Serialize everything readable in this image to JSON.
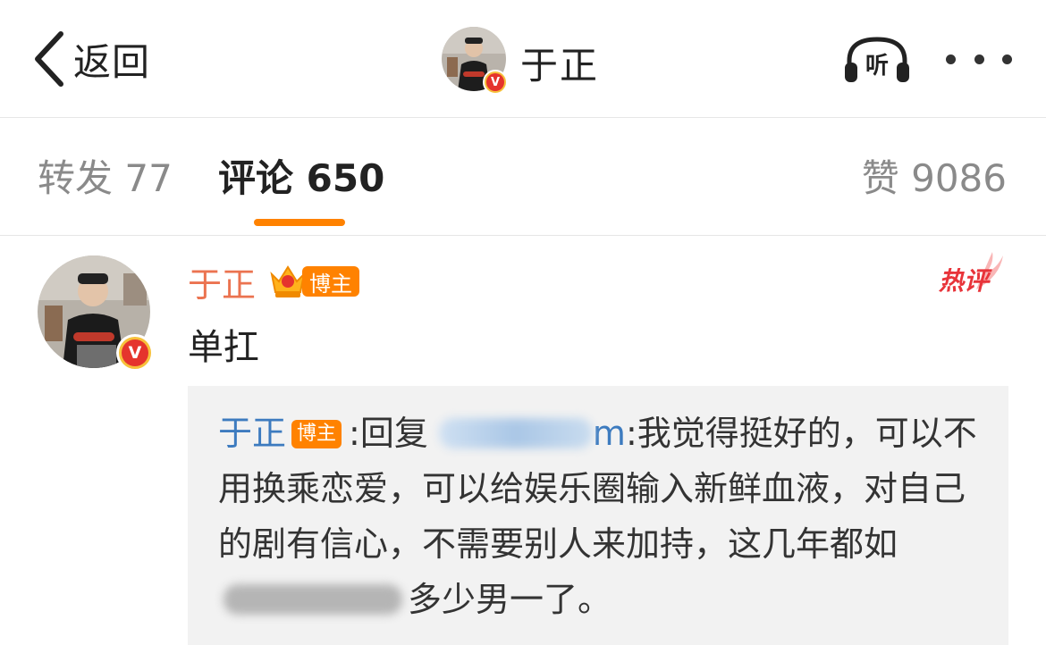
{
  "header": {
    "back_label": "返回",
    "title": "于正",
    "listen_label": "听"
  },
  "tabs": {
    "repost": "转发 77",
    "comments": "评论 650",
    "likes": "赞 9086"
  },
  "comment": {
    "author": "于正",
    "blogger_badge": "博主",
    "hot_label": "热评",
    "text": "单扛"
  },
  "reply": {
    "author": "于正",
    "blogger_badge": "博主",
    "prefix": ":回复 ",
    "mention_suffix": "m",
    "body_1": ":我觉得挺好的，可以不用换乘恋爱，可以给娱乐圈输入新鲜血液，对自己的剧有信心，不需要别人来加持，这几年都如",
    "body_2": "多少男一了。"
  },
  "colors": {
    "accent_orange": "#ff8200",
    "name_orange": "#eb7350",
    "reply_name_blue": "#3d7bbf",
    "verified_red": "#e5342d",
    "verified_gold": "#f7c13b"
  }
}
